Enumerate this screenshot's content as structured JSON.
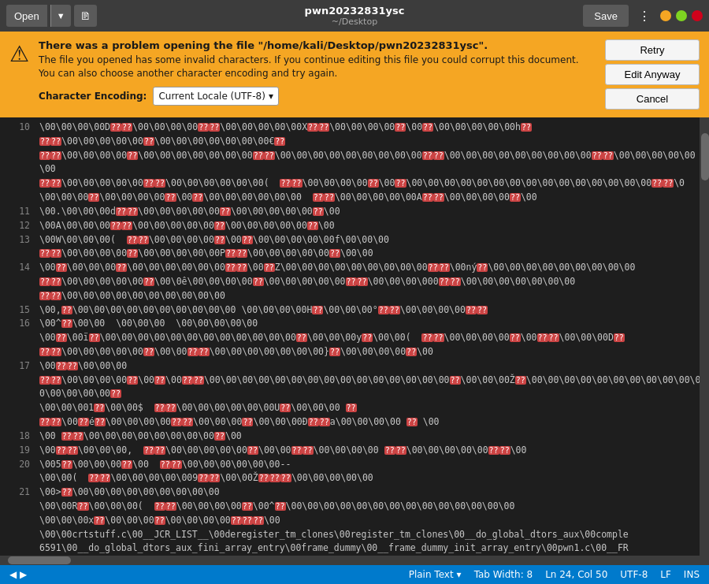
{
  "titlebar": {
    "open_label": "Open",
    "save_label": "Save",
    "title": "pwn20232831ysc",
    "subtitle": "~/Desktop",
    "menu_icon": "⋮",
    "open_arrow": "▼",
    "attach_icon": "🖹"
  },
  "warning": {
    "title": "There was a problem opening the file \"/home/kali/Desktop/pwn20232831ysc\".",
    "body1": "The file you opened has some invalid characters. If you continue editing this file you could corrupt this document.",
    "body2": "You can also choose another character encoding and try again.",
    "encoding_label": "Character Encoding:",
    "encoding_value": "Current Locale (UTF-8)",
    "retry_label": "Retry",
    "edit_anyway_label": "Edit Anyway",
    "cancel_label": "Cancel"
  },
  "code_lines": [
    {
      "num": "10",
      "text": "\\00\\00\\00\\00D[?][?]\\00\\00\\00\\00[?][?]\\00\\00\\00\\00\\00X[?][?]\\00\\00\\00\\00[?]\\00[?]\\00\\00\\00\\00\\00h[?]"
    },
    {
      "num": "",
      "text": "[?][?]\\00\\00\\00\\00\\00[?]\\00\\00\\00\\00\\00\\00\\00€[?]"
    },
    {
      "num": "",
      "text": "[?][?]\\00\\00\\00\\00[?]\\00\\00\\00\\00\\00\\00\\00[?][?]\\00\\00\\00\\00\\00\\00\\00\\00\\00[?][?]\\00\\00\\00\\00\\00\\00\\00\\00\\00[?][?]\\00\\00\\00\\00\\00\\00"
    },
    {
      "num": "",
      "text": "[?][?]\\00\\00\\00\\00\\00[?][?]\\00\\00\\00\\00\\00\\00(  [?][?]\\00\\00\\00\\00[?]\\00[?]\\00\\00\\00\\00\\00\\00\\00\\00\\00\\00\\00\\00\\00\\00\\00[?][?]\\0"
    },
    {
      "num": "",
      "text": "\\00\\00\\00[?]\\00\\00\\00\\00[?]\\00[?]\\00\\00\\00\\00\\00\\00  [?][?]\\00\\00\\00\\00\\00A[?][?]\\00\\00\\00\\00[?]\\00"
    },
    {
      "num": "11",
      "text": "\\00.\\00\\00\\00d[?][?]\\00\\00\\00\\00\\00[?]\\00\\00\\00\\00\\00[?]\\00"
    },
    {
      "num": "12",
      "text": "\\00A\\00\\00\\00[?][?]\\00\\00\\00\\00\\00[?]\\00\\00\\00\\00\\00[?]\\00"
    },
    {
      "num": "13",
      "text": "\\00W\\00\\00\\00(  [?][?]\\00\\00\\00\\00[?]\\00[?]\\00\\00\\00\\00\\00f\\00\\00\\00"
    },
    {
      "num": "",
      "text": "[?][?]\\00\\00\\00\\00[?]\\00\\00\\00\\00\\00P[?][?]\\00\\00\\00\\00\\00[?]\\00\\00"
    },
    {
      "num": "14",
      "text": "\\00[?]\\00\\00\\00[?]\\00\\00\\00\\00\\00\\00[?][?]\\00[?]Z\\00\\00\\00\\00\\00\\00\\00\\00\\00[?][?]\\00ný[?]\\00\\00\\00\\00\\00\\00\\00\\00\\00"
    },
    {
      "num": "",
      "text": "[?][?]\\00\\00\\00\\00\\00[?]\\00\\0ê\\00\\00\\00\\00[?]\\00\\00\\00\\00\\00[?][?]\\00\\00\\00\\000[?][?]\\00\\00\\00\\00\\00\\00\\00"
    },
    {
      "num": "",
      "text": "[?][?]\\00\\00\\00\\00\\00\\00\\00\\00\\00\\00"
    },
    {
      "num": "15",
      "text": "\\00,[?]\\00\\00\\00\\00\\00\\00\\00\\00\\00\\00 \\00\\00\\00\\00H[?]\\00\\00\\00°[?][?]\\00\\00\\00\\00[?][?]"
    },
    {
      "num": "16",
      "text": "\\00^[?]\\00\\00  \\00\\00\\00  \\00\\00\\00\\00\\00"
    },
    {
      "num": "",
      "text": "\\00[?]\\00ï[?]\\00\\00\\00\\00\\00\\00\\00\\00\\00\\00\\00\\00[?]\\00\\00\\00y[?]\\00\\00(  [?][?]\\00\\00\\00\\00[?]\\00[?][?]\\00\\00\\00D[?]"
    },
    {
      "num": "",
      "text": "[?][?]\\00\\00\\00\\00\\00[?]\\00\\00[?][?]\\00\\00\\00\\00\\00\\00\\00}[?]\\00\\00\\00\\00[?]\\00"
    },
    {
      "num": "17",
      "text": "\\00[?][?]\\00\\00\\00"
    },
    {
      "num": "",
      "text": "[?][?]\\00\\00\\00\\00[?]\\00[?]\\00[?][?]\\00\\00\\00\\00\\00\\00\\00\\00\\00\\00\\00\\00\\00\\00\\00[?]\\00\\00\\00Ž[?]\\00\\00\\00\\00\\00\\00\\00\\00\\00\\00\\00\\00\\00\\00\\00[?]"
    },
    {
      "num": "",
      "text": "\\00\\00\\001[?]\\00\\00$  [?][?]\\00\\00\\00\\00\\00\\00U[?]\\00\\00\\00 [?]"
    },
    {
      "num": "",
      "text": "[?][?]\\00[?]é[?]\\00\\00\\00\\00[?][?]\\00\\00\\00[?]\\00\\00\\00Ð[?][?]a\\00\\00\\00\\00 [?] \\00"
    },
    {
      "num": "18",
      "text": "\\00 [?][?]\\00\\00\\00\\00\\00\\00\\00\\00[?]\\00"
    },
    {
      "num": "19",
      "text": "\\00[?][?]\\00\\00\\00,  [?][?]\\00\\00\\00\\00\\00[?]\\00\\00[?][?]\\00\\00\\00\\00 [?][?]\\00\\00\\00\\00\\00[?][?]\\00"
    },
    {
      "num": "20",
      "text": "\\005[?]\\00\\00\\00[?]\\00  [?][?]\\00\\00\\00\\00\\00\\00--"
    },
    {
      "num": "",
      "text": "\\00\\00(  [?][?]\\00\\00\\00\\00\\009[?][?]\\00\\00Ž[?][?][?]\\00\\00\\00\\00\\00"
    },
    {
      "num": "21",
      "text": "\\00>[?]\\00\\00\\00\\00\\00\\00\\00\\00\\00"
    },
    {
      "num": "",
      "text": "\\00\\00R[?]\\00\\00\\00(  [?][?]\\00\\00\\00\\00[?]\\00^[?]\\00\\00\\00\\00\\00\\00\\00\\00\\00\\00\\00\\00\\00\\00"
    },
    {
      "num": "",
      "text": "\\00\\00\\00x[?]\\00\\00\\00[?]\\00\\00\\00\\00[?][?][?]\\00"
    },
    {
      "num": "",
      "text": "\\00\\00crtstuff.c\\00__JCR_LIST__\\00deregister_tm_clones\\00register_tm_clones\\00__do_global_dtors_aux\\00comple"
    },
    {
      "num": "",
      "text": "6591\\00__do_global_dtors_aux_fini_array_entry\\00frame_dummy\\00__frame_dummy_init_array_entry\\00pwn1.c\\00__FR"
    }
  ],
  "status_bar": {
    "plain_text_label": "Plain Text",
    "tab_label": "Tab Width: 8",
    "position_label": "Ln 24, Col 50",
    "encoding_label": "UTF-8",
    "line_ending_label": "LF",
    "overwrite_label": "INS"
  }
}
